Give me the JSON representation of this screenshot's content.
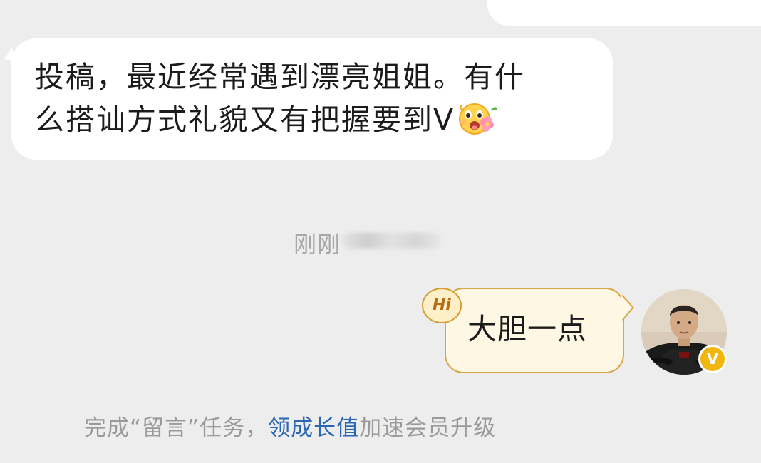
{
  "top": {
    "left_fragment": "",
    "right_fragment": ""
  },
  "incoming": {
    "text": "投稿，最近经常遇到漂亮姐姐。有什\n么搭讪方式礼貌又有把握要到V"
  },
  "timestamp": {
    "label": "刚刚"
  },
  "outgoing": {
    "badge": "Hi",
    "text": "大胆一点"
  },
  "avatar": {
    "verified_mark": "V"
  },
  "footer": {
    "prefix": "完成“留言”任务，",
    "link": "领成长值",
    "suffix": "加速会员升级"
  },
  "colors": {
    "background": "#ededed",
    "incoming_bubble": "#ffffff",
    "outgoing_bubble": "#fdf7e3",
    "outgoing_border": "#d6a64a",
    "link": "#2a66b3",
    "verified": "#f2b70f"
  },
  "icons": [
    "flower-smile-emoji-icon",
    "hi-badge-icon",
    "verified-badge-icon"
  ]
}
